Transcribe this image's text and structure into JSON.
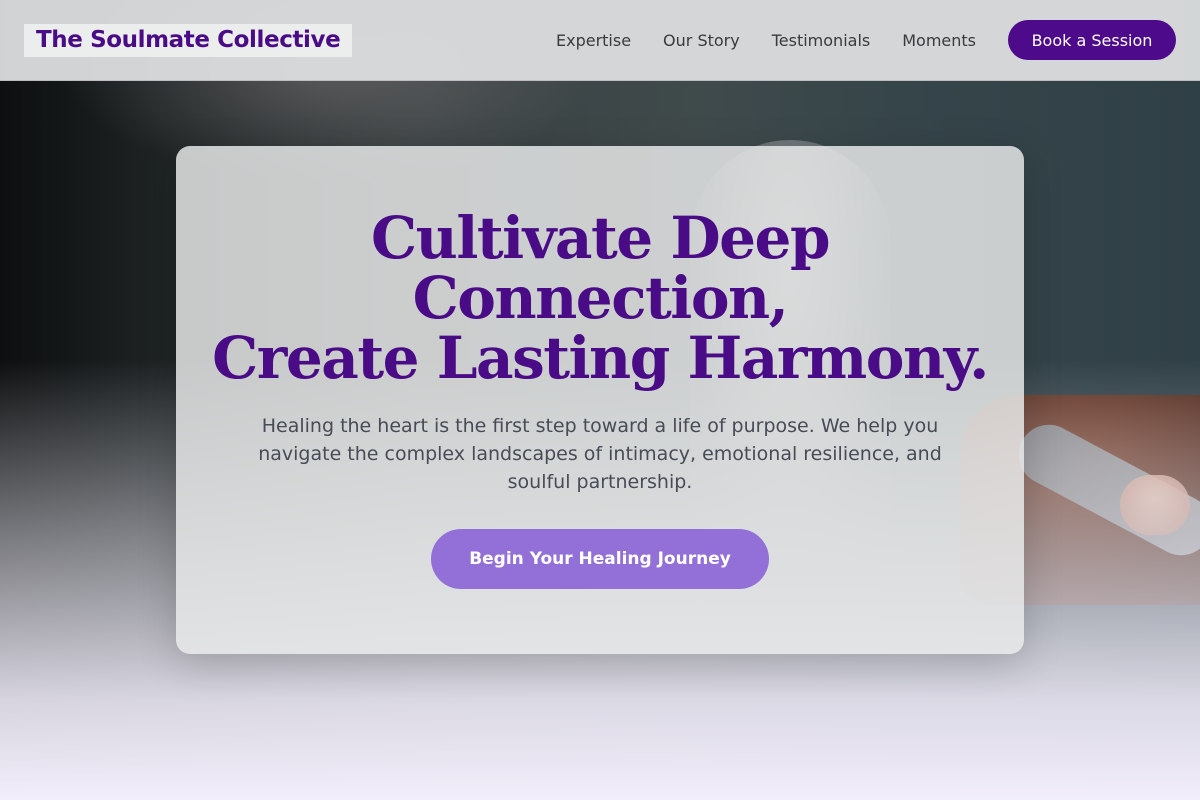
{
  "header": {
    "logo": "The Soulmate Collective",
    "nav": [
      {
        "label": "Expertise"
      },
      {
        "label": "Our Story"
      },
      {
        "label": "Testimonials"
      },
      {
        "label": "Moments"
      }
    ],
    "cta_label": "Book a Session"
  },
  "hero": {
    "title_lines": [
      "Cultivate Deep",
      "Connection,",
      "Create Lasting Harmony."
    ],
    "subtitle": "Healing the heart is the first step toward a life of purpose. We help you navigate the complex landscapes of intimacy, emotional resilience, and soulful partnership.",
    "cta_label": "Begin Your Healing Journey"
  },
  "colors": {
    "brand_purple": "#4a0b86",
    "cta_purple": "#9370d8",
    "header_bg": "#dedfe0"
  }
}
